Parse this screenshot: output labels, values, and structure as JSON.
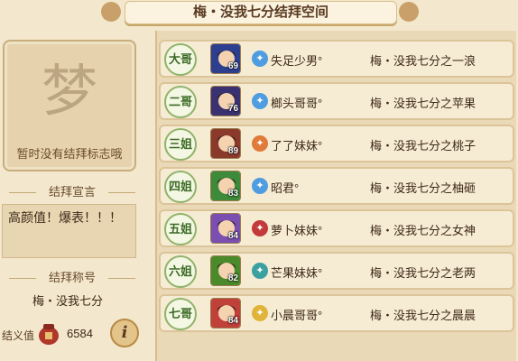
{
  "window": {
    "title": "梅・没我七分结拜空间"
  },
  "left": {
    "emblem_placeholder": "暂时没有结拜标志哦",
    "declaration_heading": "结拜宣言",
    "declaration_text": "高颜值！爆表！！！",
    "title_heading": "结拜称号",
    "title_value": "梅・没我七分",
    "jieyi_label": "结义值",
    "jieyi_value": "6584",
    "info_label": "i"
  },
  "members": [
    {
      "rank": "大哥",
      "level": "69",
      "name": "失足少男°",
      "title": "梅・没我七分之一浪",
      "sect_icon": "wind-icon",
      "sect_color": "#4f9de0",
      "avatar_color": "#2d3f8f"
    },
    {
      "rank": "二哥",
      "level": "76",
      "name": "榔头哥哥°",
      "title": "梅・没我七分之苹果",
      "sect_icon": "wind-icon",
      "sect_color": "#4f9de0",
      "avatar_color": "#3a3270"
    },
    {
      "rank": "三姐",
      "level": "89",
      "name": "了了妹妹°",
      "title": "梅・没我七分之桃子",
      "sect_icon": "flame-icon",
      "sect_color": "#e07a3a",
      "avatar_color": "#8a3a2a"
    },
    {
      "rank": "四姐",
      "level": "83",
      "name": "昭君°",
      "title": "梅・没我七分之柚砸",
      "sect_icon": "wind-icon",
      "sect_color": "#4f9de0",
      "avatar_color": "#3d8a3a"
    },
    {
      "rank": "五姐",
      "level": "84",
      "name": "萝卜妹妹°",
      "title": "梅・没我七分之女神",
      "sect_icon": "flower-icon",
      "sect_color": "#c23a3a",
      "avatar_color": "#7a4fb0"
    },
    {
      "rank": "六姐",
      "level": "82",
      "name": "芒果妹妹°",
      "title": "梅・没我七分之老两",
      "sect_icon": "water-icon",
      "sect_color": "#3aa0a0",
      "avatar_color": "#4a8a2a"
    },
    {
      "rank": "七哥",
      "level": "84",
      "name": "小晨哥哥°",
      "title": "梅・没我七分之晨晨",
      "sect_icon": "sun-icon",
      "sect_color": "#e0b43a",
      "avatar_color": "#c0403a"
    }
  ]
}
